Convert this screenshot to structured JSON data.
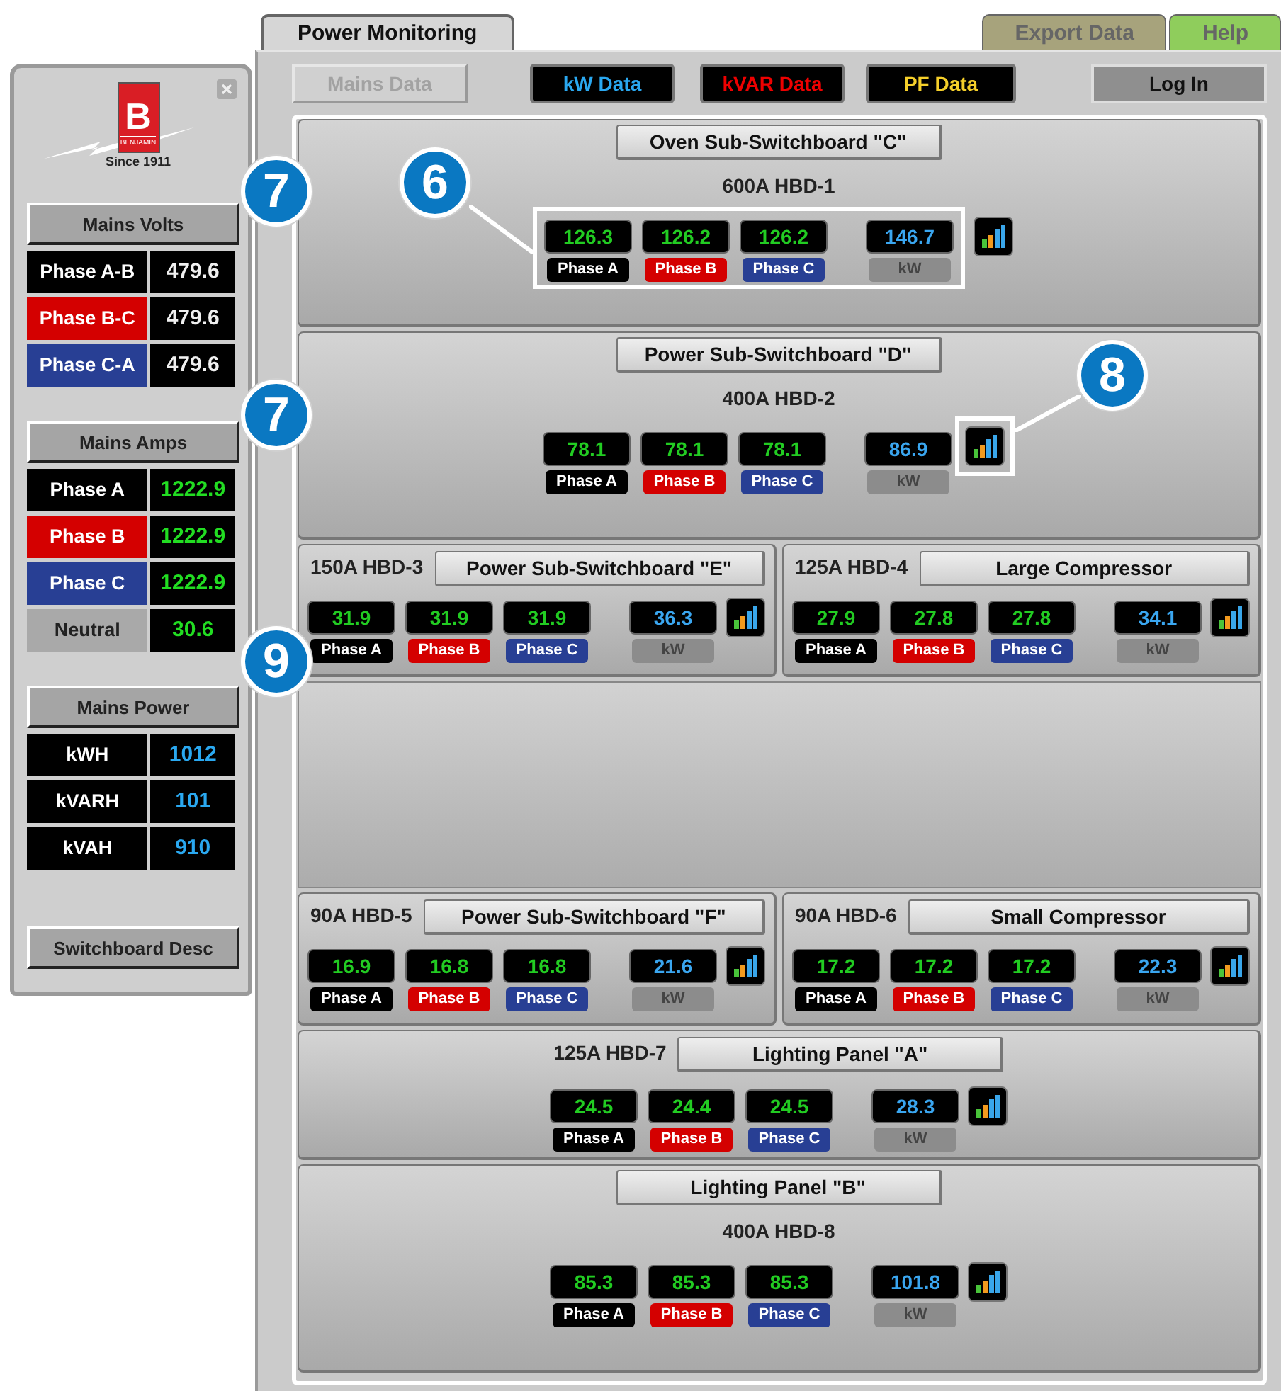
{
  "tabs": [
    {
      "label": "Power Monitoring",
      "selected": true,
      "color": "#d6d6d6"
    },
    {
      "label": "Export Data",
      "selected": false,
      "color": "#a7a37c"
    },
    {
      "label": "Help",
      "selected": false,
      "color": "#8fcd5c"
    }
  ],
  "side_panel": {
    "logo": {
      "letter": "B",
      "name": "BENJAMIN",
      "tagline": "Since 1911"
    },
    "sections": [
      {
        "title": "Mains Volts",
        "kind": "volts",
        "callout": "7",
        "rows": [
          {
            "label": "Phase A-B",
            "value": "479.6",
            "color": "#000000"
          },
          {
            "label": "Phase B-C",
            "value": "479.6",
            "color": "#d40000"
          },
          {
            "label": "Phase C-A",
            "value": "479.6",
            "color": "#283f94"
          }
        ]
      },
      {
        "title": "Mains Amps",
        "kind": "amps",
        "callout": "7",
        "rows": [
          {
            "label": "Phase A",
            "value": "1222.9",
            "color": "#000000"
          },
          {
            "label": "Phase B",
            "value": "1222.9",
            "color": "#d40000"
          },
          {
            "label": "Phase C",
            "value": "1222.9",
            "color": "#283f94"
          },
          {
            "label": "Neutral",
            "value": "30.6",
            "color": "#a9a9a9"
          }
        ]
      },
      {
        "title": "Mains Power",
        "kind": "power",
        "callout": "9",
        "rows": [
          {
            "label": "kWH",
            "value": "1012",
            "color": "#000000"
          },
          {
            "label": "kVARH",
            "value": "101",
            "color": "#000000"
          },
          {
            "label": "kVAH",
            "value": "910",
            "color": "#000000"
          }
        ]
      }
    ],
    "button": "Switchboard Desc"
  },
  "toolbar": [
    {
      "label": "Mains Data",
      "kind": "plain",
      "disabled": true
    },
    {
      "label": "kW Data",
      "kind": "kw",
      "disabled": false
    },
    {
      "label": "kVAR Data",
      "kind": "kvar",
      "disabled": false
    },
    {
      "label": "PF Data",
      "kind": "pf",
      "disabled": false
    },
    {
      "label": "Log In",
      "kind": "login",
      "disabled": false
    }
  ],
  "rows": [
    {
      "kind": "full",
      "card": {
        "title": "Oven Sub-Switchboard \"C\"",
        "circuit": "600A HBD-1",
        "kind": "stacked",
        "callout": {
          "kind": "readings",
          "label": "6"
        },
        "readings": [
          {
            "value": "126.3",
            "label": "Phase A",
            "kind": "phase",
            "color": "#000000"
          },
          {
            "value": "126.2",
            "label": "Phase B",
            "kind": "phase",
            "color": "#d40000"
          },
          {
            "value": "126.2",
            "label": "Phase C",
            "kind": "phase",
            "color": "#283f94"
          },
          {
            "value": "146.7",
            "label": "kW",
            "kind": "power",
            "color": "#8c8c8c"
          }
        ]
      }
    },
    {
      "kind": "full",
      "card": {
        "title": "Power Sub-Switchboard \"D\"",
        "circuit": "400A HBD-2",
        "kind": "stacked",
        "callout": {
          "kind": "chart",
          "label": "8"
        },
        "readings": [
          {
            "value": "78.1",
            "label": "Phase A",
            "kind": "phase",
            "color": "#000000"
          },
          {
            "value": "78.1",
            "label": "Phase B",
            "kind": "phase",
            "color": "#d40000"
          },
          {
            "value": "78.1",
            "label": "Phase C",
            "kind": "phase",
            "color": "#283f94"
          },
          {
            "value": "86.9",
            "label": "kW",
            "kind": "power",
            "color": "#8c8c8c"
          }
        ]
      }
    },
    {
      "kind": "pair",
      "cards": [
        {
          "title": "Power Sub-Switchboard \"E\"",
          "circuit": "150A HBD-3",
          "kind": "inline",
          "readings": [
            {
              "value": "31.9",
              "label": "Phase A",
              "kind": "phase",
              "color": "#000000"
            },
            {
              "value": "31.9",
              "label": "Phase B",
              "kind": "phase",
              "color": "#d40000"
            },
            {
              "value": "31.9",
              "label": "Phase C",
              "kind": "phase",
              "color": "#283f94"
            },
            {
              "value": "36.3",
              "label": "kW",
              "kind": "power",
              "color": "#8c8c8c"
            }
          ]
        },
        {
          "title": "Large Compressor",
          "circuit": "125A HBD-4",
          "kind": "inline",
          "readings": [
            {
              "value": "27.9",
              "label": "Phase A",
              "kind": "phase",
              "color": "#000000"
            },
            {
              "value": "27.8",
              "label": "Phase B",
              "kind": "phase",
              "color": "#d40000"
            },
            {
              "value": "27.8",
              "label": "Phase C",
              "kind": "phase",
              "color": "#283f94"
            },
            {
              "value": "34.1",
              "label": "kW",
              "kind": "power",
              "color": "#8c8c8c"
            }
          ]
        }
      ]
    },
    {
      "kind": "empty"
    },
    {
      "kind": "pair",
      "cards": [
        {
          "title": "Power Sub-Switchboard \"F\"",
          "circuit": "90A HBD-5",
          "kind": "inline",
          "readings": [
            {
              "value": "16.9",
              "label": "Phase A",
              "kind": "phase",
              "color": "#000000"
            },
            {
              "value": "16.8",
              "label": "Phase B",
              "kind": "phase",
              "color": "#d40000"
            },
            {
              "value": "16.8",
              "label": "Phase C",
              "kind": "phase",
              "color": "#283f94"
            },
            {
              "value": "21.6",
              "label": "kW",
              "kind": "power",
              "color": "#8c8c8c"
            }
          ]
        },
        {
          "title": "Small Compressor",
          "circuit": "90A HBD-6",
          "kind": "inline",
          "readings": [
            {
              "value": "17.2",
              "label": "Phase A",
              "kind": "phase",
              "color": "#000000"
            },
            {
              "value": "17.2",
              "label": "Phase B",
              "kind": "phase",
              "color": "#d40000"
            },
            {
              "value": "17.2",
              "label": "Phase C",
              "kind": "phase",
              "color": "#283f94"
            },
            {
              "value": "22.3",
              "label": "kW",
              "kind": "power",
              "color": "#8c8c8c"
            }
          ]
        }
      ]
    },
    {
      "kind": "full",
      "card": {
        "title": "Lighting Panel \"A\"",
        "circuit": "125A HBD-7",
        "kind": "inline",
        "readings": [
          {
            "value": "24.5",
            "label": "Phase A",
            "kind": "phase",
            "color": "#000000"
          },
          {
            "value": "24.4",
            "label": "Phase B",
            "kind": "phase",
            "color": "#d40000"
          },
          {
            "value": "24.5",
            "label": "Phase C",
            "kind": "phase",
            "color": "#283f94"
          },
          {
            "value": "28.3",
            "label": "kW",
            "kind": "power",
            "color": "#8c8c8c"
          }
        ]
      }
    },
    {
      "kind": "full",
      "card": {
        "title": "Lighting Panel \"B\"",
        "circuit": "400A HBD-8",
        "kind": "stacked",
        "readings": [
          {
            "value": "85.3",
            "label": "Phase A",
            "kind": "phase",
            "color": "#000000"
          },
          {
            "value": "85.3",
            "label": "Phase B",
            "kind": "phase",
            "color": "#d40000"
          },
          {
            "value": "85.3",
            "label": "Phase C",
            "kind": "phase",
            "color": "#283f94"
          },
          {
            "value": "101.8",
            "label": "kW",
            "kind": "power",
            "color": "#8c8c8c"
          }
        ]
      }
    }
  ]
}
